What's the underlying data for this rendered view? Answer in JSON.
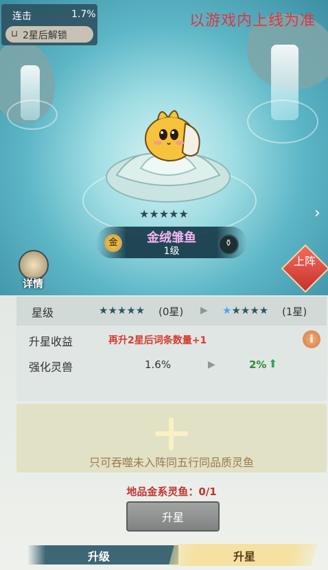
{
  "overlay": {
    "watermark": "以游戏内上线为准"
  },
  "stats": {
    "combo_label": "连击",
    "combo_value": "1.7%",
    "unlock_text": "2星后解锁"
  },
  "fish": {
    "stars": "★★★★★",
    "element_icon": "金",
    "name": "金绒雏鱼",
    "level": "1级"
  },
  "side_buttons": {
    "details": "详情",
    "deploy": "上阵"
  },
  "attributes": {
    "star_label": "星级",
    "star_current": "(0星)",
    "star_next": "(1星)",
    "upstar_gain_label": "升星收益",
    "upstar_gain_text": "再升2星后词条数量+1",
    "info_icon": "i",
    "enhance_label": "强化灵兽",
    "enhance_current": "1.6%",
    "enhance_next": "2%"
  },
  "feed": {
    "hint": "只可吞噬未入阵同五行同品质灵鱼"
  },
  "requirement": {
    "text": "地品金系灵鱼：0/1"
  },
  "actions": {
    "upstar_button": "升星"
  },
  "tabs": [
    {
      "label": "升级",
      "active": false
    },
    {
      "label": "升星",
      "active": true
    }
  ],
  "colors": {
    "accent_red": "#d63a2f",
    "name_pink": "#f3b6f0",
    "green_up": "#2f8d2f"
  }
}
